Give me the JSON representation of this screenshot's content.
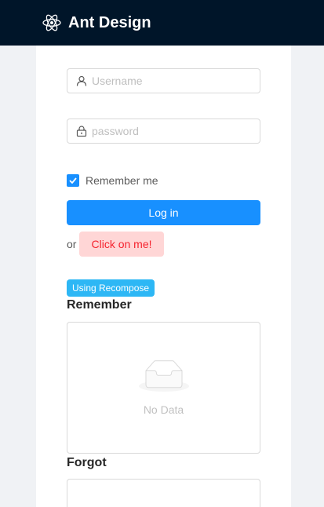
{
  "header": {
    "title": "Ant Design",
    "logo_icon": "react-atom-icon"
  },
  "form": {
    "username": {
      "placeholder": "Username",
      "value": "",
      "icon": "user-icon"
    },
    "password": {
      "placeholder": "password",
      "value": "",
      "icon": "lock-icon"
    },
    "remember": {
      "label": "Remember me",
      "checked": true
    },
    "login_label": "Log in",
    "or_text": "or",
    "click_label": "Click on me!"
  },
  "tag_label": "Using Recompose",
  "sections": {
    "remember_title": "Remember",
    "remember_empty": "No Data",
    "forgot_title": "Forgot"
  },
  "colors": {
    "header_bg": "#001529",
    "primary": "#1890ff",
    "tag": "#2db7f5",
    "danger_text": "#f5222d",
    "danger_bg": "#ffd6d6"
  }
}
